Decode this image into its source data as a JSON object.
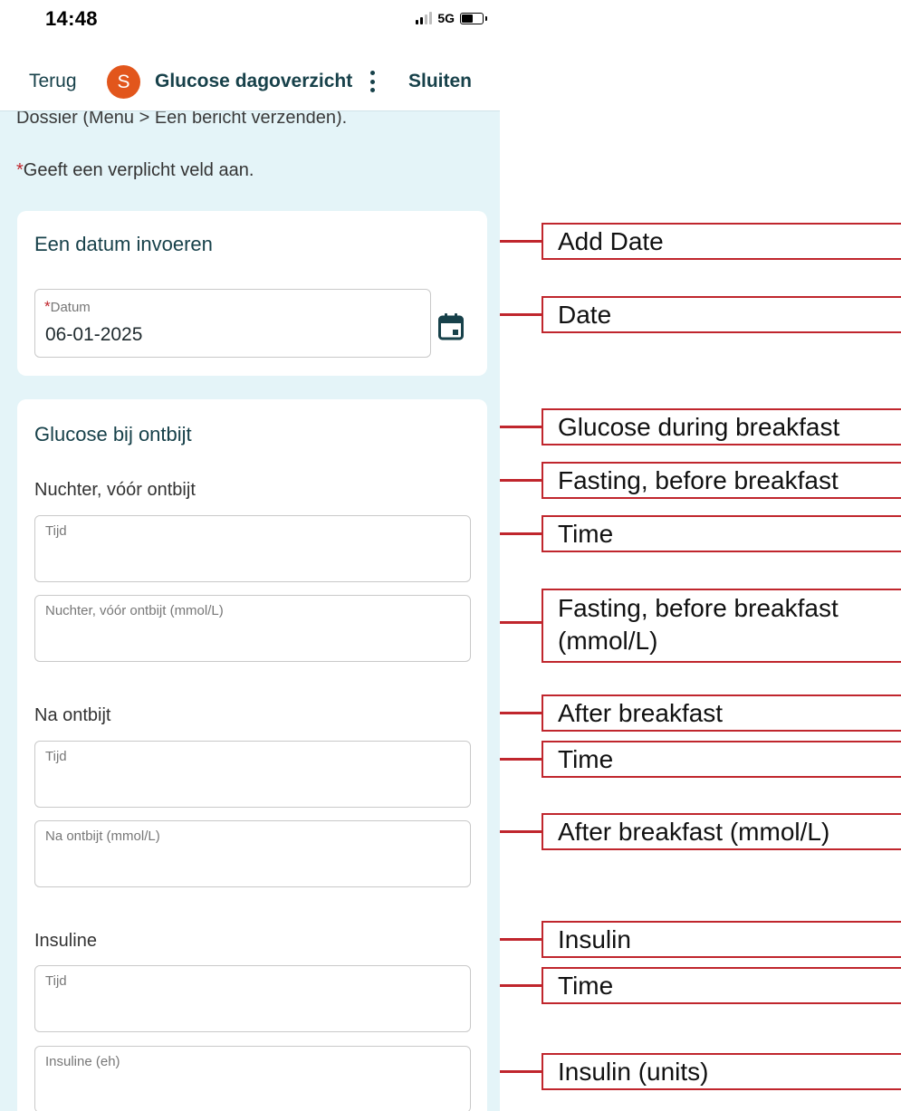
{
  "status_bar": {
    "time": "14:48",
    "network": "5G"
  },
  "nav": {
    "back_label": "Terug",
    "avatar_letter": "S",
    "title": "Glucose dagoverzicht",
    "close_label": "Sluiten"
  },
  "intro": {
    "cut_text": "Dossier (Menu > Een bericht verzenden).",
    "required_star": "*",
    "required_note": "Geeft een verplicht veld aan."
  },
  "date_card": {
    "heading": "Een datum invoeren",
    "field_label": "Datum",
    "field_value": "06-01-2025"
  },
  "glucose_card": {
    "heading": "Glucose bij ontbijt",
    "sections": [
      {
        "label": "Nuchter, vóór ontbijt",
        "time_label": "Tijd",
        "value_label": "Nuchter, vóór ontbijt (mmol/L)"
      },
      {
        "label": "Na ontbijt",
        "time_label": "Tijd",
        "value_label": "Na ontbijt (mmol/L)"
      },
      {
        "label": "Insuline",
        "time_label": "Tijd",
        "value_label": "Insuline (eh)"
      }
    ]
  },
  "annotations": [
    "Add Date",
    "Date",
    "Glucose during breakfast",
    "Fasting, before breakfast",
    "Time",
    "Fasting, before breakfast (mmol/L)",
    "After breakfast",
    "Time",
    "After breakfast (mmol/L)",
    "Insulin",
    "Time",
    "Insulin (units)"
  ],
  "colors": {
    "accent_red": "#c0262d",
    "avatar_orange": "#e2561c",
    "nav_text": "#17414a",
    "content_bg": "#e4f4f8"
  }
}
